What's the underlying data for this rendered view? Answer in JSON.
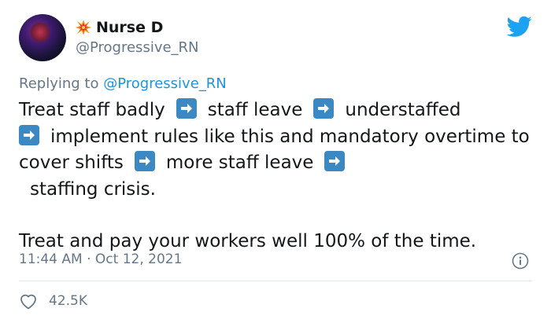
{
  "author": {
    "display_name": "Nurse D",
    "handle": "@Progressive_RN",
    "avatar_icon": "avatar-portrait",
    "badge_icon": "collision-emoji-icon"
  },
  "reply": {
    "prefix": "Replying to",
    "mention": "@Progressive_RN"
  },
  "body": {
    "seg1": "Treat staff badly",
    "seg2": "staff leave",
    "seg3": "understaffed",
    "seg4": "implement rules like this and mandatory overtime to cover shifts",
    "seg5": "more staff leave",
    "seg6": "staffing crisis.",
    "paragraph2": "Treat and pay your workers well 100% of the time."
  },
  "meta": {
    "time": "11:44 AM",
    "separator": "·",
    "date": "Oct 12, 2021"
  },
  "engagement": {
    "likes": "42.5K"
  },
  "colors": {
    "twitter_blue": "#1da1f2",
    "link_blue": "#1b95e0",
    "arrow_blue": "#3b88c3",
    "muted_gray": "#657786",
    "text": "#14171a",
    "divider": "#e1e8ed"
  }
}
